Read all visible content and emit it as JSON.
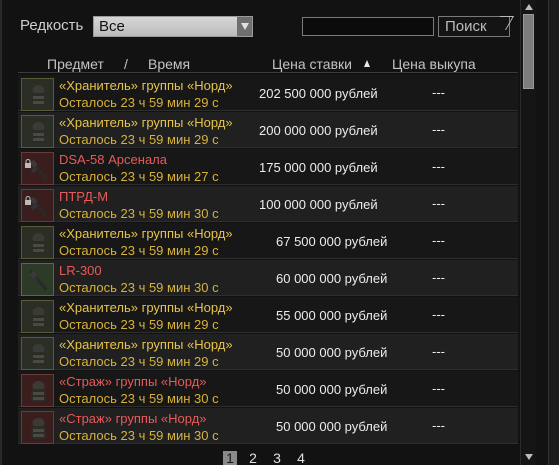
{
  "filter": {
    "rarity_label": "Редкость",
    "rarity_value": "Все",
    "search_value": "",
    "search_button": "Поиск"
  },
  "header": {
    "item": "Предмет",
    "separator": "/",
    "time": "Время",
    "bid": "Цена ставки",
    "buyout": "Цена выкупа"
  },
  "rows": [
    {
      "name": "«Хранитель» группы «Норд»",
      "time": "Осталось 23 ч 59 мин 29 с",
      "bid": "202 500 000 рублей",
      "buyout": "---",
      "name_color": "#e6c44a",
      "icon": "armor-icon",
      "locked": false
    },
    {
      "name": "«Хранитель» группы «Норд»",
      "time": "Осталось 23 ч 59 мин 29 с",
      "bid": "200 000 000 рублей",
      "buyout": "---",
      "name_color": "#e6c44a",
      "icon": "armor-icon",
      "locked": false
    },
    {
      "name": "DSA-58 Арсенала",
      "time": "Осталось 23 ч 59 мин 27 с",
      "bid": "175 000 000 рублей",
      "buyout": "---",
      "name_color": "#e85a5a",
      "icon": "rifle-icon",
      "locked": true
    },
    {
      "name": "ПТРД-М",
      "time": "Осталось 23 ч 59 мин 30 с",
      "bid": "100 000 000 рублей",
      "buyout": "---",
      "name_color": "#e85a5a",
      "icon": "rifle-icon",
      "locked": true
    },
    {
      "name": "«Хранитель» группы «Норд»",
      "time": "Осталось 23 ч 59 мин 29 с",
      "bid": "67 500 000 рублей",
      "buyout": "---",
      "name_color": "#e6c44a",
      "icon": "armor-icon",
      "locked": false
    },
    {
      "name": "LR-300",
      "time": "Осталось 23 ч 59 мин 30 с",
      "bid": "60 000 000 рублей",
      "buyout": "---",
      "name_color": "#e85a5a",
      "icon": "rifle-icon",
      "locked": false
    },
    {
      "name": "«Хранитель» группы «Норд»",
      "time": "Осталось 23 ч 59 мин 29 с",
      "bid": "55 000 000 рублей",
      "buyout": "---",
      "name_color": "#e6c44a",
      "icon": "armor-icon",
      "locked": false
    },
    {
      "name": "«Хранитель» группы «Норд»",
      "time": "Осталось 23 ч 59 мин 29 с",
      "bid": "50 000 000 рублей",
      "buyout": "---",
      "name_color": "#e6c44a",
      "icon": "armor-icon",
      "locked": false
    },
    {
      "name": "«Страж» группы «Норд»",
      "time": "Осталось 23 ч 59 мин 30 с",
      "bid": "50 000 000 рублей",
      "buyout": "---",
      "name_color": "#e85a5a",
      "icon": "armor-icon",
      "locked": false
    },
    {
      "name": "«Страж» группы «Норд»",
      "time": "Осталось 23 ч 59 мин 30 с",
      "bid": "50 000 000 рублей",
      "buyout": "---",
      "name_color": "#e85a5a",
      "icon": "armor-icon",
      "locked": false
    }
  ],
  "pagination": {
    "pages": [
      "1",
      "2",
      "3",
      "4"
    ],
    "current": "1"
  }
}
